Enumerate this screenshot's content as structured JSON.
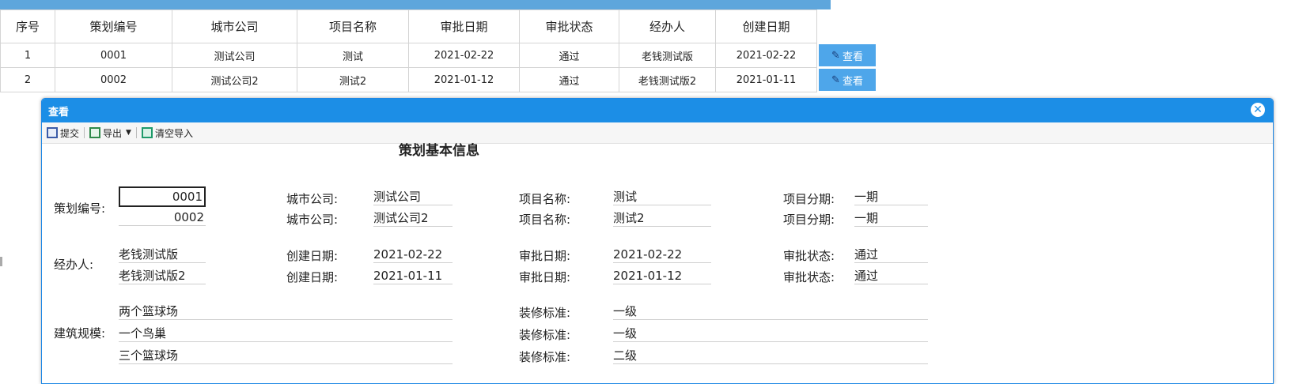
{
  "grid": {
    "columns": [
      "序号",
      "策划编号",
      "城市公司",
      "项目名称",
      "审批日期",
      "审批状态",
      "经办人",
      "创建日期"
    ],
    "rows": [
      [
        "1",
        "0001",
        "测试公司",
        "测试",
        "2021-02-22",
        "通过",
        "老钱测试版",
        "2021-02-22"
      ],
      [
        "2",
        "0002",
        "测试公司2",
        "测试2",
        "2021-01-12",
        "通过",
        "老钱测试版2",
        "2021-01-11"
      ]
    ],
    "view_label": "查看"
  },
  "dialog": {
    "title": "查看",
    "toolbar": {
      "submit": "提交",
      "export": "导出",
      "clear_import": "清空导入"
    },
    "form_title": "策划基本信息",
    "labels": {
      "plan_no": "策划编号:",
      "city_company": "城市公司:",
      "project_name": "项目名称:",
      "project_phase": "项目分期:",
      "handler": "经办人:",
      "create_date": "创建日期:",
      "approve_date": "审批日期:",
      "approve_status": "审批状态:",
      "building_scale": "建筑规模:",
      "decoration_std": "装修标准:"
    },
    "records": [
      {
        "plan_no": "0001",
        "city_company": "测试公司",
        "project_name": "测试",
        "project_phase": "一期",
        "handler": "老钱测试版",
        "create_date": "2021-02-22",
        "approve_date": "2021-02-22",
        "approve_status": "通过"
      },
      {
        "plan_no": "0002",
        "city_company": "测试公司2",
        "project_name": "测试2",
        "project_phase": "一期",
        "handler": "老钱测试版2",
        "create_date": "2021-01-11",
        "approve_date": "2021-01-12",
        "approve_status": "通过"
      }
    ],
    "scale_rows": [
      {
        "scale": "两个篮球场",
        "decoration": "一级"
      },
      {
        "scale": "一个鸟巢",
        "decoration": "一级"
      },
      {
        "scale": "三个篮球场",
        "decoration": "二级"
      }
    ]
  },
  "colors": {
    "accent": "#1c8ee6",
    "button": "#4ea6ea",
    "topbar": "#5ea6dc"
  }
}
